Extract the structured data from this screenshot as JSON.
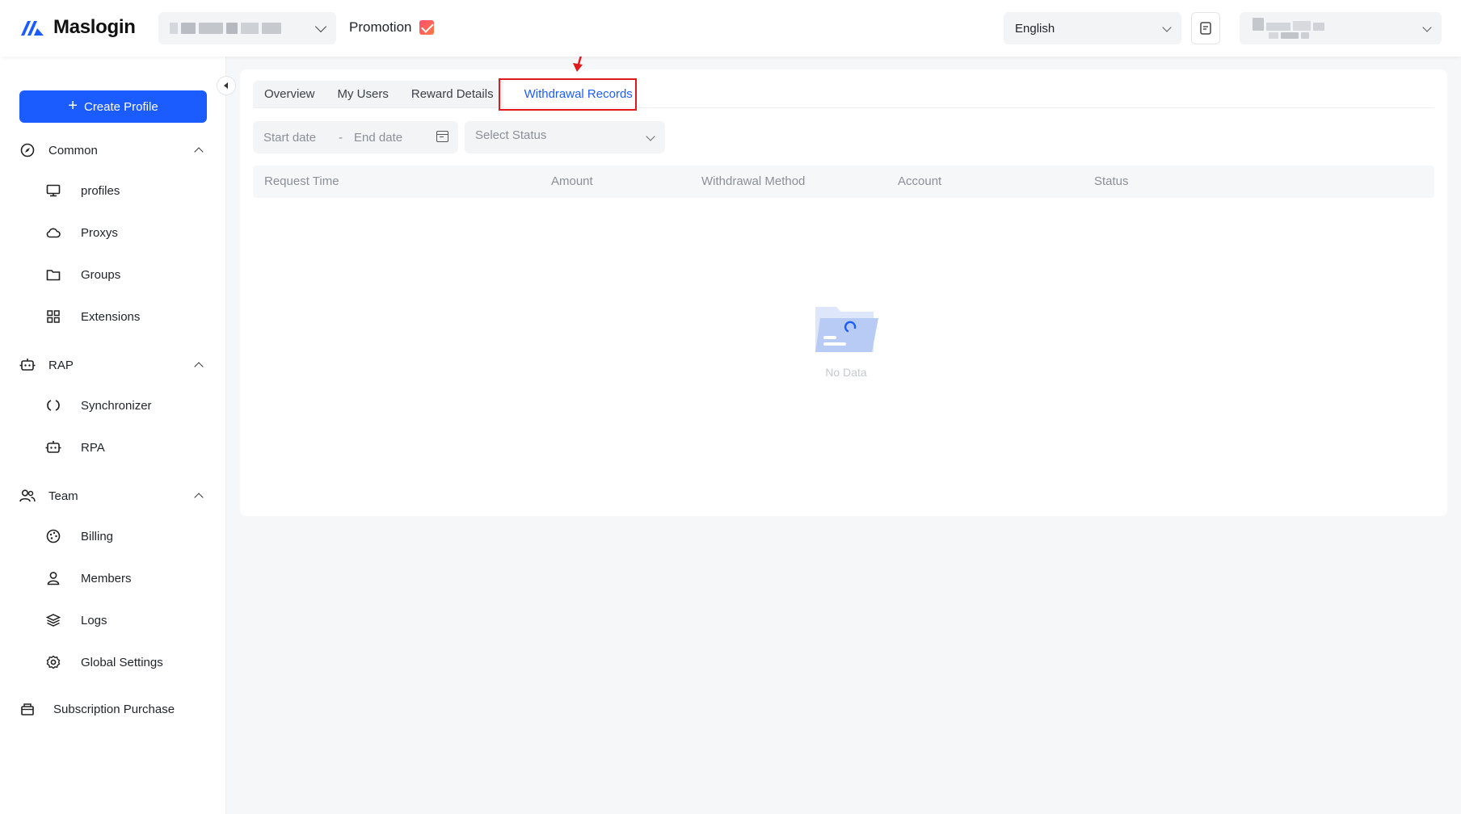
{
  "header": {
    "app_name": "Maslogin",
    "promotion_label": "Promotion",
    "language": "English"
  },
  "sidebar": {
    "create_label": "Create Profile",
    "groups": [
      {
        "label": "Common",
        "items": [
          "profiles",
          "Proxys",
          "Groups",
          "Extensions"
        ]
      },
      {
        "label": "RAP",
        "items": [
          "Synchronizer",
          "RPA"
        ]
      },
      {
        "label": "Team",
        "items": [
          "Billing",
          "Members",
          "Logs",
          "Global Settings"
        ]
      }
    ],
    "subscription_label": "Subscription Purchase"
  },
  "tabs": [
    "Overview",
    "My Users",
    "Reward Details",
    "Withdrawal Records"
  ],
  "active_tab": "Withdrawal Records",
  "filters": {
    "start_placeholder": "Start date",
    "date_separator": "-",
    "end_placeholder": "End date",
    "status_placeholder": "Select Status"
  },
  "table": {
    "columns": [
      "Request Time",
      "Amount",
      "Withdrawal Method",
      "Account",
      "Status"
    ]
  },
  "empty_text": "No Data",
  "colors": {
    "accent": "#1a5cff",
    "highlight_box": "#e0191b"
  }
}
